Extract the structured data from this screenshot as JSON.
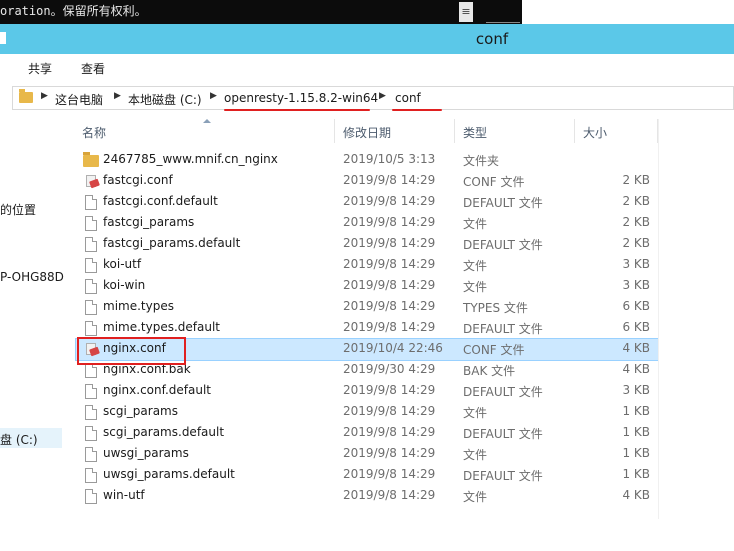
{
  "console": {
    "text": "oration。保留所有权利。",
    "scroll_glyph": "≡"
  },
  "window": {
    "title": "conf"
  },
  "ribbon": {
    "tabs": [
      "共享",
      "查看"
    ]
  },
  "address": {
    "crumbs": [
      "这台电脑",
      "本地磁盘 (C:)",
      "openresty-1.15.8.2-win64",
      "conf"
    ]
  },
  "nav": {
    "items": [
      "的位置",
      "P-OHG88D",
      "盘 (C:)"
    ]
  },
  "list": {
    "columns": {
      "name": "名称",
      "date": "修改日期",
      "type": "类型",
      "size": "大小"
    },
    "rows": [
      {
        "icon": "folder-icon",
        "name": "2467785_www.mnif.cn_nginx",
        "date": "2019/10/5 3:13",
        "type": "文件夹",
        "size": ""
      },
      {
        "icon": "conf-file-icon",
        "name": "fastcgi.conf",
        "date": "2019/9/8 14:29",
        "type": "CONF 文件",
        "size": "2 KB"
      },
      {
        "icon": "file-icon",
        "name": "fastcgi.conf.default",
        "date": "2019/9/8 14:29",
        "type": "DEFAULT 文件",
        "size": "2 KB"
      },
      {
        "icon": "file-icon",
        "name": "fastcgi_params",
        "date": "2019/9/8 14:29",
        "type": "文件",
        "size": "2 KB"
      },
      {
        "icon": "file-icon",
        "name": "fastcgi_params.default",
        "date": "2019/9/8 14:29",
        "type": "DEFAULT 文件",
        "size": "2 KB"
      },
      {
        "icon": "file-icon",
        "name": "koi-utf",
        "date": "2019/9/8 14:29",
        "type": "文件",
        "size": "3 KB"
      },
      {
        "icon": "file-icon",
        "name": "koi-win",
        "date": "2019/9/8 14:29",
        "type": "文件",
        "size": "3 KB"
      },
      {
        "icon": "file-icon",
        "name": "mime.types",
        "date": "2019/9/8 14:29",
        "type": "TYPES 文件",
        "size": "6 KB"
      },
      {
        "icon": "file-icon",
        "name": "mime.types.default",
        "date": "2019/9/8 14:29",
        "type": "DEFAULT 文件",
        "size": "6 KB"
      },
      {
        "icon": "conf-file-icon",
        "name": "nginx.conf",
        "date": "2019/10/4 22:46",
        "type": "CONF 文件",
        "size": "4 KB",
        "selected": true
      },
      {
        "icon": "file-icon",
        "name": "nginx.conf.bak",
        "date": "2019/9/30 4:29",
        "type": "BAK 文件",
        "size": "4 KB"
      },
      {
        "icon": "file-icon",
        "name": "nginx.conf.default",
        "date": "2019/9/8 14:29",
        "type": "DEFAULT 文件",
        "size": "3 KB"
      },
      {
        "icon": "file-icon",
        "name": "scgi_params",
        "date": "2019/9/8 14:29",
        "type": "文件",
        "size": "1 KB"
      },
      {
        "icon": "file-icon",
        "name": "scgi_params.default",
        "date": "2019/9/8 14:29",
        "type": "DEFAULT 文件",
        "size": "1 KB"
      },
      {
        "icon": "file-icon",
        "name": "uwsgi_params",
        "date": "2019/9/8 14:29",
        "type": "文件",
        "size": "1 KB"
      },
      {
        "icon": "file-icon",
        "name": "uwsgi_params.default",
        "date": "2019/9/8 14:29",
        "type": "DEFAULT 文件",
        "size": "1 KB"
      },
      {
        "icon": "file-icon",
        "name": "win-utf",
        "date": "2019/9/8 14:29",
        "type": "文件",
        "size": "4 KB"
      }
    ]
  },
  "colors": {
    "titlebar": "#5bc8e8",
    "selection": "#cce8ff",
    "annotation_red": "#e02020"
  }
}
